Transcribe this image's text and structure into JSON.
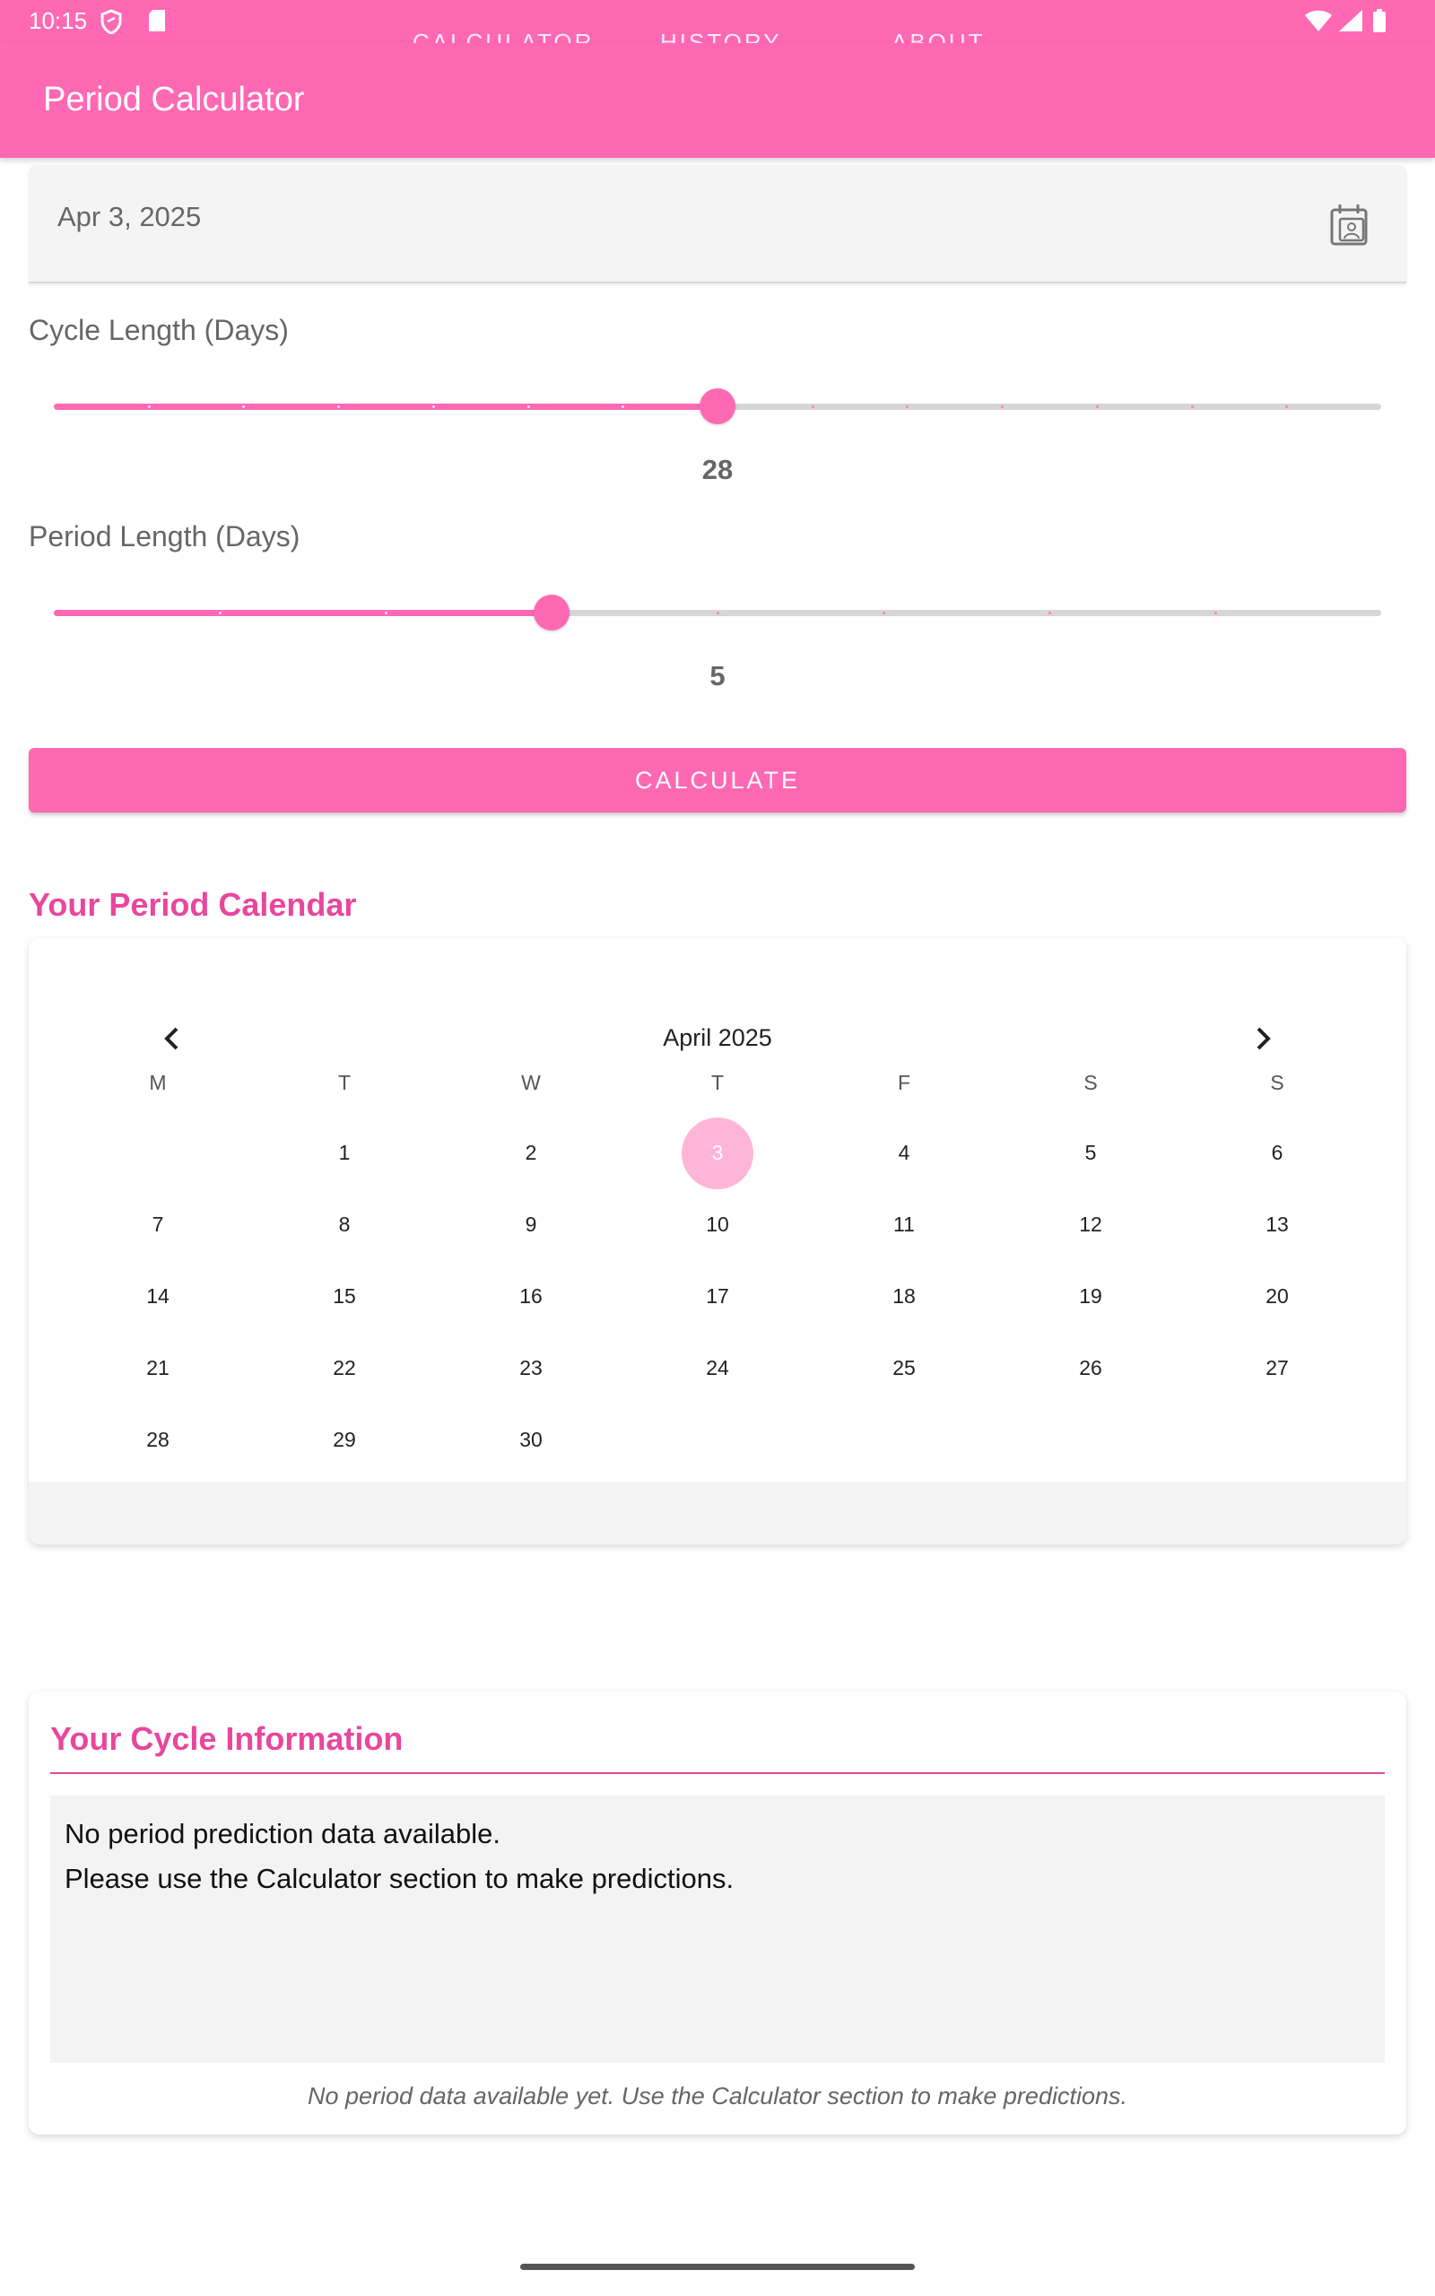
{
  "status_bar": {
    "time": "10:15"
  },
  "tabs": [
    "CALCULATOR",
    "HISTORY",
    "ABOUT"
  ],
  "app_bar": {
    "title": "Period Calculator"
  },
  "date_input": {
    "value": "Apr 3, 2025"
  },
  "cycle_length": {
    "label": "Cycle Length (Days)",
    "value": "28",
    "fraction": 0.5
  },
  "period_length": {
    "label": "Period Length (Days)",
    "value": "5",
    "fraction": 0.375
  },
  "calculate_button": {
    "label": "CALCULATE"
  },
  "calendar": {
    "section_title": "Your Period Calendar",
    "month": "April 2025",
    "weekdays": [
      "M",
      "T",
      "W",
      "T",
      "F",
      "S",
      "S"
    ],
    "start_offset": 1,
    "days": [
      "1",
      "2",
      "3",
      "4",
      "5",
      "6",
      "7",
      "8",
      "9",
      "10",
      "11",
      "12",
      "13",
      "14",
      "15",
      "16",
      "17",
      "18",
      "19",
      "20",
      "21",
      "22",
      "23",
      "24",
      "25",
      "26",
      "27",
      "28",
      "29",
      "30"
    ],
    "selected_day": "3"
  },
  "cycle_info": {
    "title": "Your Cycle Information",
    "line1": "No period prediction data available.",
    "line2": "Please use the Calculator section to make predictions.",
    "note": "No period data available yet. Use the Calculator section to make predictions."
  },
  "colors": {
    "accent": "#ff69b4",
    "heading": "#e8479e",
    "selected_day": "#ffb5d8"
  }
}
